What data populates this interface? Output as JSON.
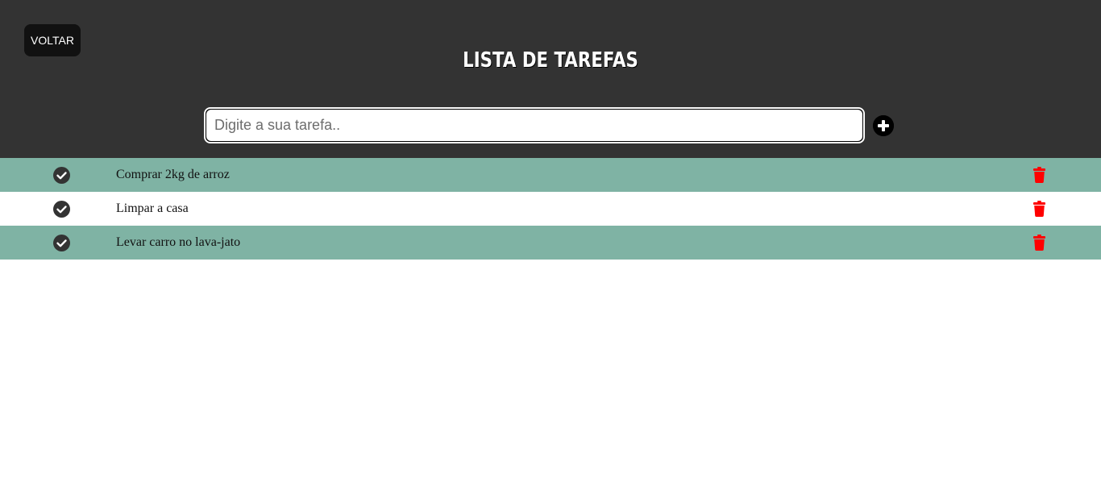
{
  "header": {
    "back_label": "VOLTAR",
    "title": "LISTA DE TAREFAS"
  },
  "input": {
    "placeholder": "Digite a sua tarefa..",
    "value": ""
  },
  "icons": {
    "add": "plus-circle-icon",
    "check": "check-circle-icon",
    "delete": "trash-icon"
  },
  "colors": {
    "header_bg": "#333333",
    "row_alt_bg": "#7fb3a4",
    "delete_red": "#ff0000"
  },
  "tasks": [
    {
      "text": "Comprar 2kg de arroz"
    },
    {
      "text": "Limpar a casa"
    },
    {
      "text": "Levar carro no lava-jato"
    }
  ]
}
